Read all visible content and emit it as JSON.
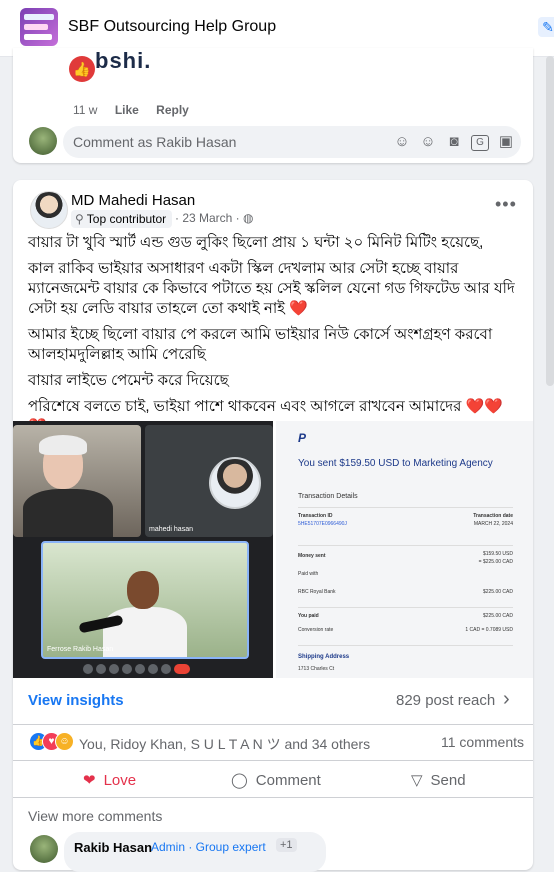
{
  "header": {
    "group_name": "SBF Outsourcing Help Group"
  },
  "prev_post": {
    "partial_text": "bshi.",
    "time": "11 w",
    "like_label": "Like",
    "reply_label": "Reply",
    "comment_placeholder": "Comment as Rakib Hasan"
  },
  "post": {
    "author": "MD Mahedi Hasan",
    "badge": "Top contributor",
    "date": "· 23 March ·",
    "paragraphs": [
      "বায়ার টা খুবি স্মার্ট এন্ড গুড লুকিং ছিলো প্রায় ১ ঘন্টা ২০ মিনিট মিটিং হয়েছে,",
      "কাল রাকিব ভাইয়ার অসাধারণ একটা স্কিল দেখলাম  আর সেটা হচ্ছে বায়ার ম্যানেজমেন্ট  বায়ার কে কিভাবে পটাতে হয় সেই স্কলিল যেনো গড গিফটেড  আর যদি সেটা হয় লেডি বায়ার তাহলে তো কথাই নাই",
      "আমার ইচ্ছে ছিলো বায়ার পে করলে আমি ভাইয়ার নিউ কোর্সে অংশগ্রহণ করবো আলহামদুলিল্লাহ  আমি পেরেছি",
      "বায়ার লাইভে পেমেন্ট করে দিয়েছে",
      "পরিশেষে বলতে চাই,  ভাইয়া পাশে থাকবেন এবং আগলে রাখবেন আমাদের"
    ],
    "heart_single": "❤️",
    "heart_triple": "❤️❤️❤️",
    "meet": {
      "tile2_label": "mahedi hasan",
      "tile3_label": "Ferrose Rakib Hasan"
    },
    "paypal": {
      "logo": "P",
      "title": "You sent $159.50 USD to Marketing Agency",
      "details_heading": "Transaction Details",
      "txn_id_label": "Transaction ID",
      "txn_id_value": "5HE51707E0966490J",
      "txn_date_label": "Transaction date",
      "txn_date_value": "MARCH 22, 2024",
      "money_sent_label": "Money sent",
      "money_sent_value": "$159.50 USD",
      "money_sent_cad": "= $225.00 CAD",
      "paid_with_label": "Paid with",
      "bank_label": "RBC Royal Bank",
      "bank_value": "$225.00 CAD",
      "you_paid_label": "You paid",
      "you_paid_value": "$225.00 CAD",
      "conv_label": "Conversion rate",
      "conv_value": "1 CAD = 0.7089 USD",
      "ship_heading": "Shipping Address",
      "ship_addr": "1713 Charles Ct"
    },
    "insights_label": "View insights",
    "reach": "829 post reach",
    "reaction_names": "You, Ridoy Khan, S  U  L  T  A  N  ツ and 34 others",
    "comments_count": "11 comments",
    "actions": {
      "love": "Love",
      "comment": "Comment",
      "send": "Send"
    },
    "view_more": "View more comments",
    "reply": {
      "name": "Rakib Hasan",
      "role": "Admin · Group expert",
      "count": "+1"
    }
  }
}
